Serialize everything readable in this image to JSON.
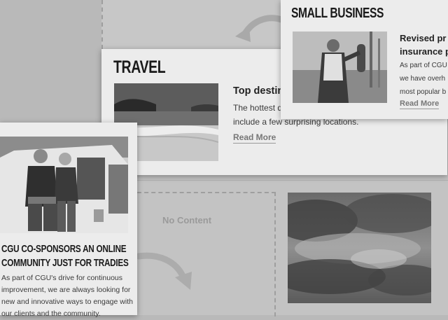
{
  "background": {
    "accent": "#b9b9b9",
    "card": "#ececec"
  },
  "travel": {
    "heading": "Travel",
    "title": "Top destin",
    "body": "The hottest d",
    "body_line2": "include a few surprising locations.",
    "read_more": "Read More"
  },
  "small_business": {
    "heading": "Small Business",
    "title": "Revised pr insurance p",
    "body_line1": "As part of CGU",
    "body_line2": "we have overh",
    "body_line3": "most popular b",
    "read_more": "Read More"
  },
  "cgu": {
    "heading_line1": "CGU co-sponsors an online",
    "heading_line2": "community just for tradies",
    "body": "As part of CGU's drive for continuous improvement, we are always looking for new and innovative ways to engage with our clients and the community."
  },
  "placeholder": {
    "text": "No Content"
  }
}
